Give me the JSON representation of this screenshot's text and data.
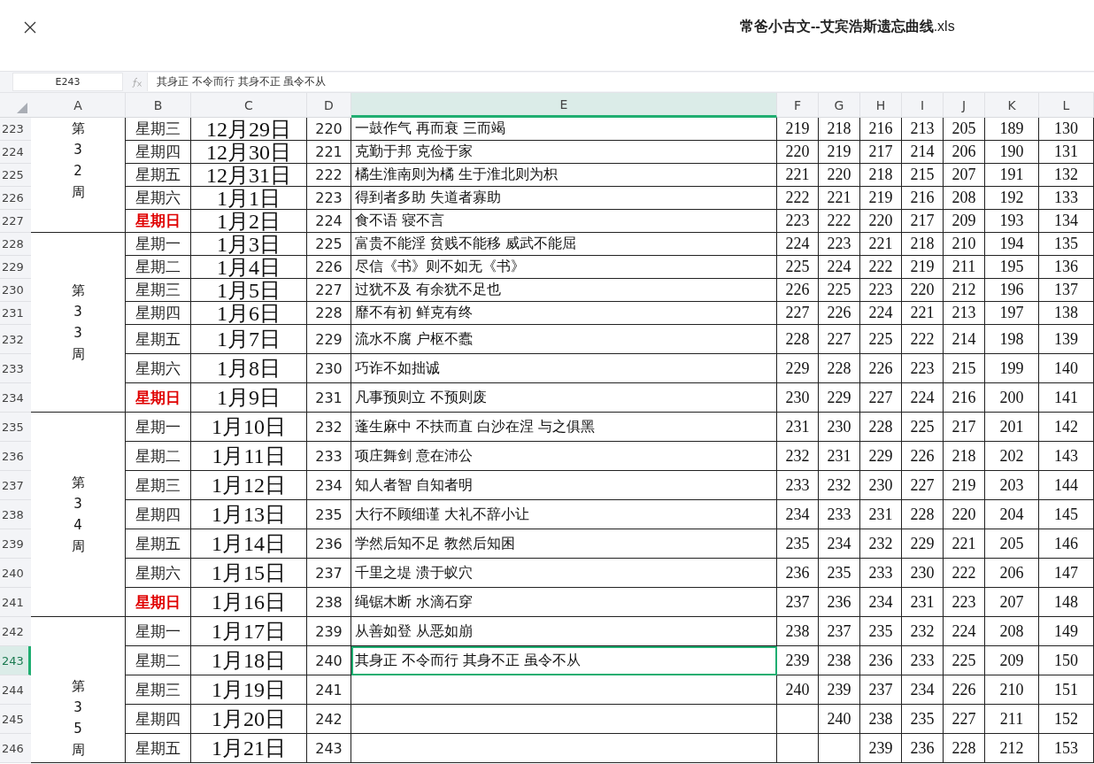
{
  "window": {
    "title": "**常爸小古文--艾宾浩斯遗忘曲线**.xls"
  },
  "name_box": "E243",
  "formula": "其身正 不令而行 其身不正 虽令不从",
  "columns": [
    {
      "label": "A",
      "selected": false
    },
    {
      "label": "B",
      "selected": false
    },
    {
      "label": "C",
      "selected": false
    },
    {
      "label": "D",
      "selected": false
    },
    {
      "label": "E",
      "selected": true
    },
    {
      "label": "F",
      "selected": false
    },
    {
      "label": "G",
      "selected": false
    },
    {
      "label": "H",
      "selected": false
    },
    {
      "label": "I",
      "selected": false
    },
    {
      "label": "J",
      "selected": false
    },
    {
      "label": "K",
      "selected": false
    },
    {
      "label": "L",
      "selected": false
    }
  ],
  "weeks": [
    {
      "label": "第32周",
      "days": [
        {
          "num": "223",
          "selected": false,
          "weekday": "星期三",
          "sunday": false,
          "date": "12月29日",
          "d": "220",
          "e": "一鼓作气 再而衰 三而竭",
          "v": {
            "F": "219",
            "G": "218",
            "H": "216",
            "I": "213",
            "J": "205",
            "K": "189",
            "L": "130"
          }
        },
        {
          "num": "224",
          "selected": false,
          "weekday": "星期四",
          "sunday": false,
          "date": "12月30日",
          "d": "221",
          "e": "克勤于邦 克俭于家",
          "v": {
            "F": "220",
            "G": "219",
            "H": "217",
            "I": "214",
            "J": "206",
            "K": "190",
            "L": "131"
          }
        },
        {
          "num": "225",
          "selected": false,
          "weekday": "星期五",
          "sunday": false,
          "date": "12月31日",
          "d": "222",
          "e": "橘生淮南则为橘 生于淮北则为枳",
          "v": {
            "F": "221",
            "G": "220",
            "H": "218",
            "I": "215",
            "J": "207",
            "K": "191",
            "L": "132"
          }
        },
        {
          "num": "226",
          "selected": false,
          "weekday": "星期六",
          "sunday": false,
          "date": "1月1日",
          "d": "223",
          "e": "得到者多助 失道者寡助",
          "v": {
            "F": "222",
            "G": "221",
            "H": "219",
            "I": "216",
            "J": "208",
            "K": "192",
            "L": "133"
          }
        },
        {
          "num": "227",
          "selected": false,
          "weekday": "星期日",
          "sunday": true,
          "date": "1月2日",
          "d": "224",
          "e": "食不语 寝不言",
          "v": {
            "F": "223",
            "G": "222",
            "H": "220",
            "I": "217",
            "J": "209",
            "K": "193",
            "L": "134"
          }
        }
      ]
    },
    {
      "label": "第33周",
      "days": [
        {
          "num": "228",
          "selected": false,
          "weekday": "星期一",
          "sunday": false,
          "date": "1月3日",
          "d": "225",
          "e": "富贵不能淫 贫贱不能移 威武不能屈",
          "v": {
            "F": "224",
            "G": "223",
            "H": "221",
            "I": "218",
            "J": "210",
            "K": "194",
            "L": "135"
          }
        },
        {
          "num": "229",
          "selected": false,
          "weekday": "星期二",
          "sunday": false,
          "date": "1月4日",
          "d": "226",
          "e": "尽信《书》则不如无《书》",
          "v": {
            "F": "225",
            "G": "224",
            "H": "222",
            "I": "219",
            "J": "211",
            "K": "195",
            "L": "136"
          }
        },
        {
          "num": "230",
          "selected": false,
          "weekday": "星期三",
          "sunday": false,
          "date": "1月5日",
          "d": "227",
          "e": "过犹不及 有余犹不足也",
          "v": {
            "F": "226",
            "G": "225",
            "H": "223",
            "I": "220",
            "J": "212",
            "K": "196",
            "L": "137"
          }
        },
        {
          "num": "231",
          "selected": false,
          "weekday": "星期四",
          "sunday": false,
          "date": "1月6日",
          "d": "228",
          "e": "靡不有初 鲜克有终",
          "v": {
            "F": "227",
            "G": "226",
            "H": "224",
            "I": "221",
            "J": "213",
            "K": "197",
            "L": "138"
          }
        },
        {
          "num": "232",
          "selected": false,
          "weekday": "星期五",
          "sunday": false,
          "date": "1月7日",
          "d": "229",
          "e": "流水不腐 户枢不蠹",
          "v": {
            "F": "228",
            "G": "227",
            "H": "225",
            "I": "222",
            "J": "214",
            "K": "198",
            "L": "139"
          }
        },
        {
          "num": "233",
          "selected": false,
          "weekday": "星期六",
          "sunday": false,
          "date": "1月8日",
          "d": "230",
          "e": "巧诈不如拙诚",
          "v": {
            "F": "229",
            "G": "228",
            "H": "226",
            "I": "223",
            "J": "215",
            "K": "199",
            "L": "140"
          }
        },
        {
          "num": "234",
          "selected": false,
          "weekday": "星期日",
          "sunday": true,
          "date": "1月9日",
          "d": "231",
          "e": "凡事预则立 不预则废",
          "v": {
            "F": "230",
            "G": "229",
            "H": "227",
            "I": "224",
            "J": "216",
            "K": "200",
            "L": "141"
          }
        }
      ]
    },
    {
      "label": "第34周",
      "days": [
        {
          "num": "235",
          "selected": false,
          "weekday": "星期一",
          "sunday": false,
          "date": "1月10日",
          "d": "232",
          "e": "蓬生麻中 不扶而直 白沙在涅 与之俱黑",
          "v": {
            "F": "231",
            "G": "230",
            "H": "228",
            "I": "225",
            "J": "217",
            "K": "201",
            "L": "142"
          }
        },
        {
          "num": "236",
          "selected": false,
          "weekday": "星期二",
          "sunday": false,
          "date": "1月11日",
          "d": "233",
          "e": "项庄舞剑 意在沛公",
          "v": {
            "F": "232",
            "G": "231",
            "H": "229",
            "I": "226",
            "J": "218",
            "K": "202",
            "L": "143"
          }
        },
        {
          "num": "237",
          "selected": false,
          "weekday": "星期三",
          "sunday": false,
          "date": "1月12日",
          "d": "234",
          "e": "知人者智 自知者明",
          "v": {
            "F": "233",
            "G": "232",
            "H": "230",
            "I": "227",
            "J": "219",
            "K": "203",
            "L": "144"
          }
        },
        {
          "num": "238",
          "selected": false,
          "weekday": "星期四",
          "sunday": false,
          "date": "1月13日",
          "d": "235",
          "e": "大行不顾细谨 大礼不辞小让",
          "v": {
            "F": "234",
            "G": "233",
            "H": "231",
            "I": "228",
            "J": "220",
            "K": "204",
            "L": "145"
          }
        },
        {
          "num": "239",
          "selected": false,
          "weekday": "星期五",
          "sunday": false,
          "date": "1月14日",
          "d": "236",
          "e": "学然后知不足 教然后知困",
          "v": {
            "F": "235",
            "G": "234",
            "H": "232",
            "I": "229",
            "J": "221",
            "K": "205",
            "L": "146"
          }
        },
        {
          "num": "240",
          "selected": false,
          "weekday": "星期六",
          "sunday": false,
          "date": "1月15日",
          "d": "237",
          "e": "千里之堤 溃于蚁穴",
          "v": {
            "F": "236",
            "G": "235",
            "H": "233",
            "I": "230",
            "J": "222",
            "K": "206",
            "L": "147"
          }
        },
        {
          "num": "241",
          "selected": false,
          "weekday": "星期日",
          "sunday": true,
          "date": "1月16日",
          "d": "238",
          "e": "绳锯木断 水滴石穿",
          "v": {
            "F": "237",
            "G": "236",
            "H": "234",
            "I": "231",
            "J": "223",
            "K": "207",
            "L": "148"
          }
        }
      ]
    },
    {
      "label": "第35周",
      "days": [
        {
          "num": "242",
          "selected": false,
          "weekday": "星期一",
          "sunday": false,
          "date": "1月17日",
          "d": "239",
          "e": "从善如登 从恶如崩",
          "v": {
            "F": "238",
            "G": "237",
            "H": "235",
            "I": "232",
            "J": "224",
            "K": "208",
            "L": "149"
          }
        },
        {
          "num": "243",
          "selected": true,
          "weekday": "星期二",
          "sunday": false,
          "date": "1月18日",
          "d": "240",
          "e": "其身正 不令而行 其身不正 虽令不从",
          "v": {
            "F": "239",
            "G": "238",
            "H": "236",
            "I": "233",
            "J": "225",
            "K": "209",
            "L": "150"
          }
        },
        {
          "num": "244",
          "selected": false,
          "weekday": "星期三",
          "sunday": false,
          "date": "1月19日",
          "d": "241",
          "v": {
            "F": "240",
            "G": "239",
            "H": "237",
            "I": "234",
            "J": "226",
            "K": "210",
            "L": "151"
          }
        },
        {
          "num": "245",
          "selected": false,
          "weekday": "星期四",
          "sunday": false,
          "date": "1月20日",
          "d": "242",
          "v": {
            "G": "240",
            "H": "238",
            "I": "235",
            "J": "227",
            "K": "211",
            "L": "152"
          }
        },
        {
          "num": "246",
          "selected": false,
          "weekday": "星期五",
          "sunday": false,
          "date": "1月21日",
          "d": "243",
          "v": {
            "H": "239",
            "I": "236",
            "J": "228",
            "K": "212",
            "L": "153"
          }
        }
      ]
    }
  ]
}
